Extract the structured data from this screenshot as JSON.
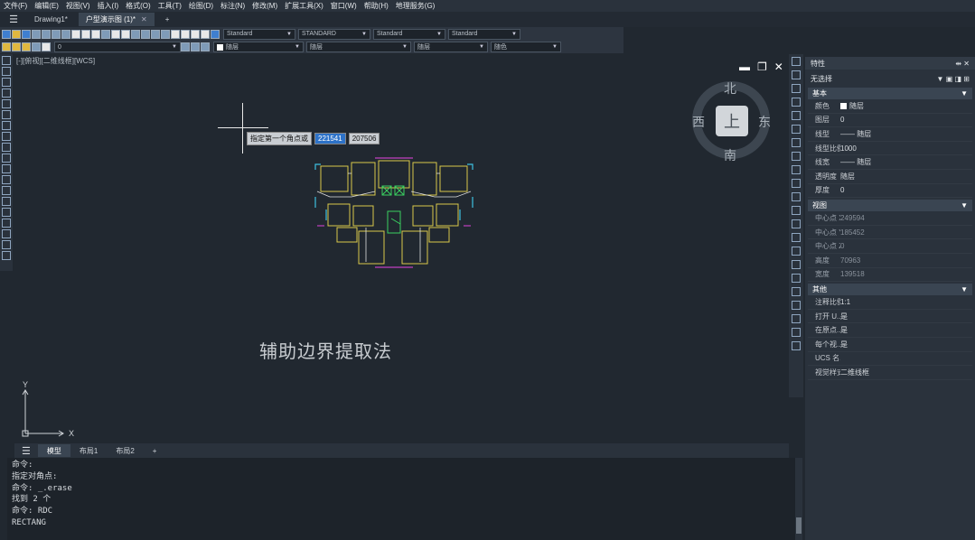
{
  "menu": [
    "文件(F)",
    "编辑(E)",
    "视图(V)",
    "插入(I)",
    "格式(O)",
    "工具(T)",
    "绘图(D)",
    "标注(N)",
    "修改(M)",
    "扩展工具(X)",
    "窗口(W)",
    "帮助(H)",
    "地理服务(G)"
  ],
  "tabs": {
    "drawing1": "Drawing1*",
    "active": "户型演示图 (1)*",
    "new": "+"
  },
  "toolbar": {
    "text_style": "Standard",
    "dim_style": "STANDARD",
    "table_style": "Standard",
    "multileader_style": "Standard",
    "layer": "0",
    "color": "随层",
    "linetype": "随层",
    "lineweight": "随层",
    "plotstyle": "随色"
  },
  "viewport": {
    "label": "[-][俯视][二维线框][WCS]"
  },
  "compass": {
    "north": "北",
    "south": "南",
    "west": "西",
    "east": "东",
    "top": "上"
  },
  "prompt": {
    "label": "指定第一个角点或",
    "x": "221541",
    "y": "207506"
  },
  "caption": "辅助边界提取法",
  "ucs": {
    "y": "Y",
    "x": "X"
  },
  "layout_tabs": [
    "模型",
    "布局1",
    "布局2",
    "+"
  ],
  "command_lines": [
    "命令:",
    "指定对角点:",
    "命令: _.erase",
    "找到 2 个",
    "命令: RDC",
    "RECTANG"
  ],
  "properties": {
    "title": "特性",
    "selection": "无选择",
    "sections": {
      "basic": "基本",
      "view": "视图",
      "other": "其他"
    },
    "basic": [
      {
        "k": "颜色",
        "v": "随层"
      },
      {
        "k": "图层",
        "v": "0"
      },
      {
        "k": "线型",
        "v": "—— 随层"
      },
      {
        "k": "线型比例",
        "v": "1000"
      },
      {
        "k": "线宽",
        "v": "—— 随层"
      },
      {
        "k": "透明度",
        "v": "随层"
      },
      {
        "k": "厚度",
        "v": "0"
      }
    ],
    "view": [
      {
        "k": "中心点 X",
        "v": "249594"
      },
      {
        "k": "中心点 Y",
        "v": "185452"
      },
      {
        "k": "中心点 Z",
        "v": "0"
      },
      {
        "k": "高度",
        "v": "70963"
      },
      {
        "k": "宽度",
        "v": "139518"
      }
    ],
    "other": [
      {
        "k": "注释比例",
        "v": "1:1"
      },
      {
        "k": "打开 U...",
        "v": "是"
      },
      {
        "k": "在原点...",
        "v": "是"
      },
      {
        "k": "每个视...",
        "v": "是"
      },
      {
        "k": "UCS 名...",
        "v": ""
      },
      {
        "k": "视觉样式",
        "v": "二维线框"
      }
    ]
  }
}
